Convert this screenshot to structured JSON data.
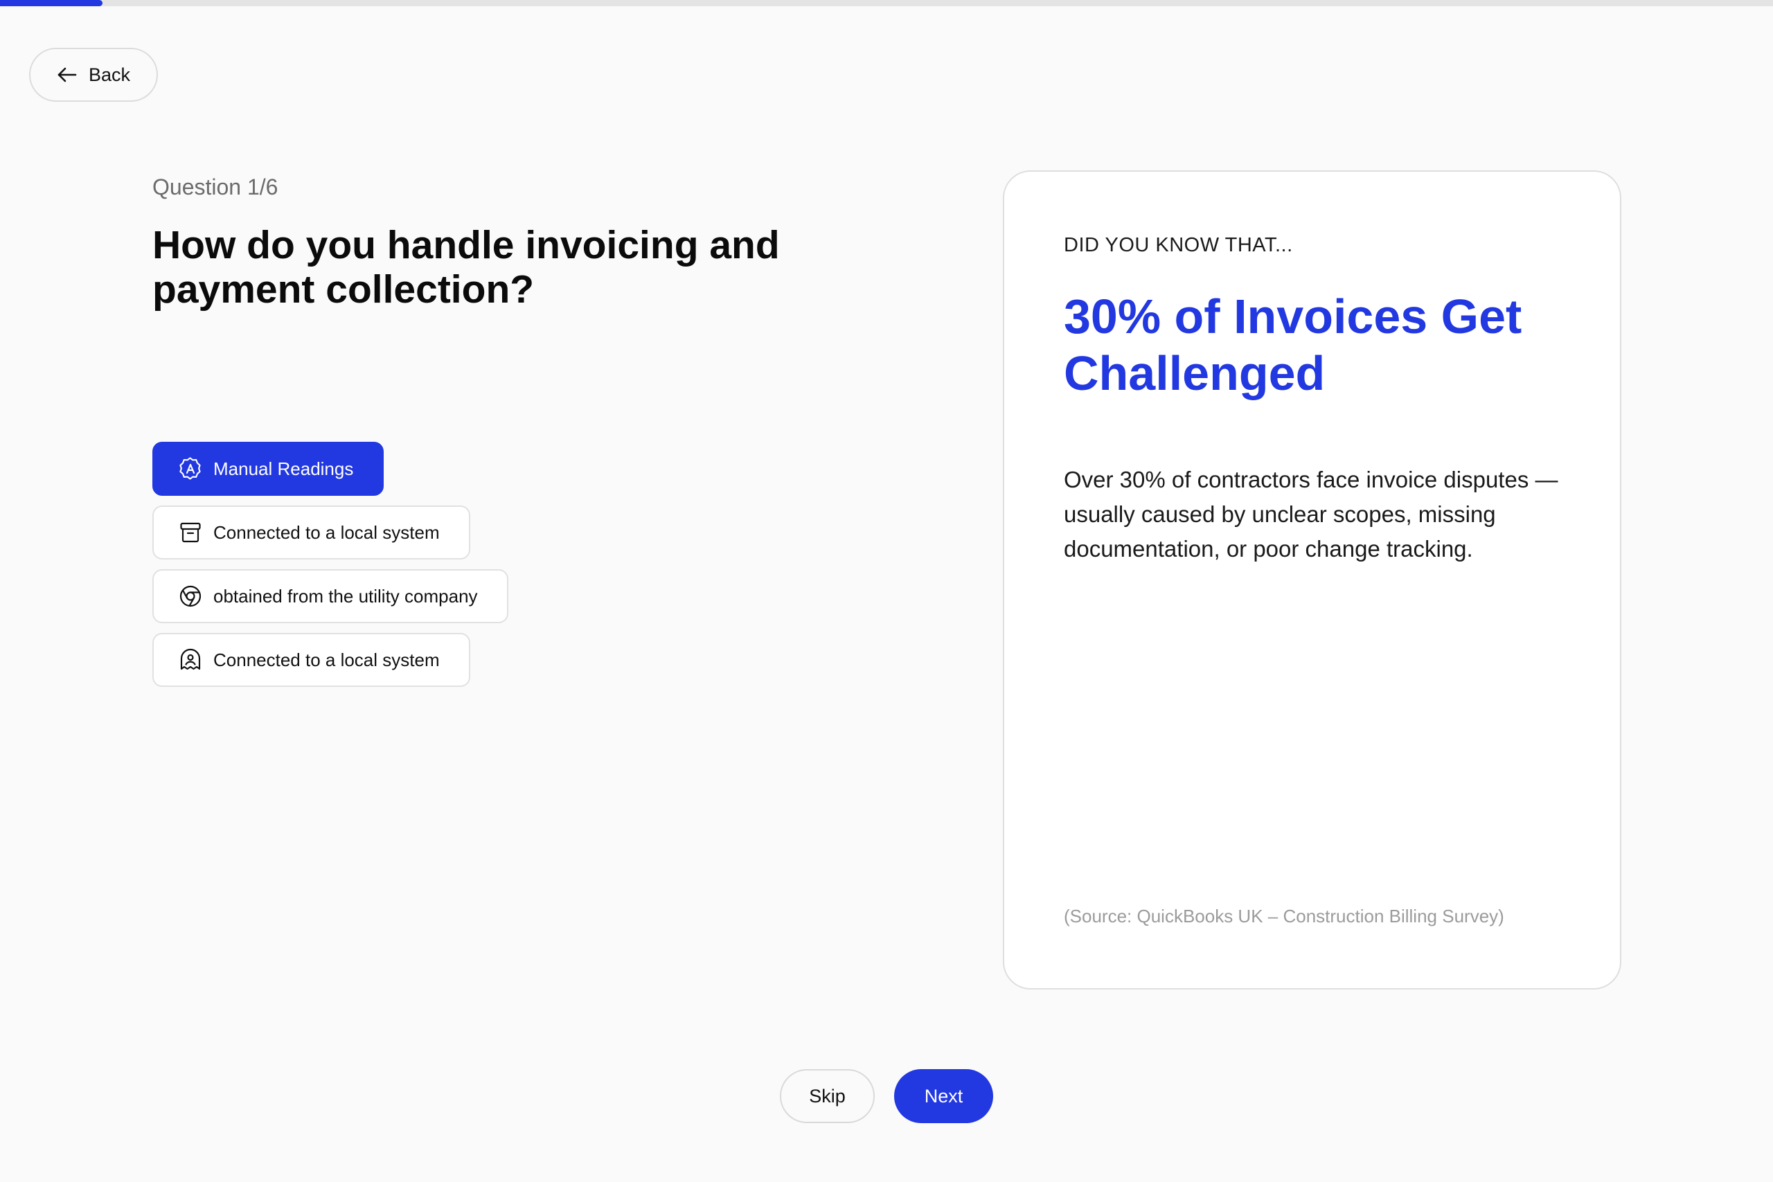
{
  "progress": {
    "value": 0.058,
    "color": "#2238e0"
  },
  "nav": {
    "back_label": "Back",
    "back_icon": "arrow-left-icon"
  },
  "question": {
    "counter": "Question 1/6",
    "title": "How do you handle invoicing and payment collection?"
  },
  "options": [
    {
      "label": "Manual Readings",
      "icon": "badge-a-icon",
      "selected": true
    },
    {
      "label": "Connected to a local system",
      "icon": "archive-box-icon",
      "selected": false
    },
    {
      "label": "obtained from the utility company",
      "icon": "chrome-circle-icon",
      "selected": false
    },
    {
      "label": "Connected to a local system",
      "icon": "user-badge-icon",
      "selected": false
    }
  ],
  "fact": {
    "kicker": "DID YOU KNOW THAT...",
    "headline": "30% of Invoices Get Challenged",
    "body": "Over 30% of contractors face invoice disputes — usually caused by unclear scopes, missing documentation, or poor change tracking.",
    "source": "(Source: QuickBooks UK – Construction Billing Survey)"
  },
  "footer": {
    "skip_label": "Skip",
    "next_label": "Next"
  },
  "colors": {
    "accent": "#2238e0",
    "background": "#fafafa"
  }
}
